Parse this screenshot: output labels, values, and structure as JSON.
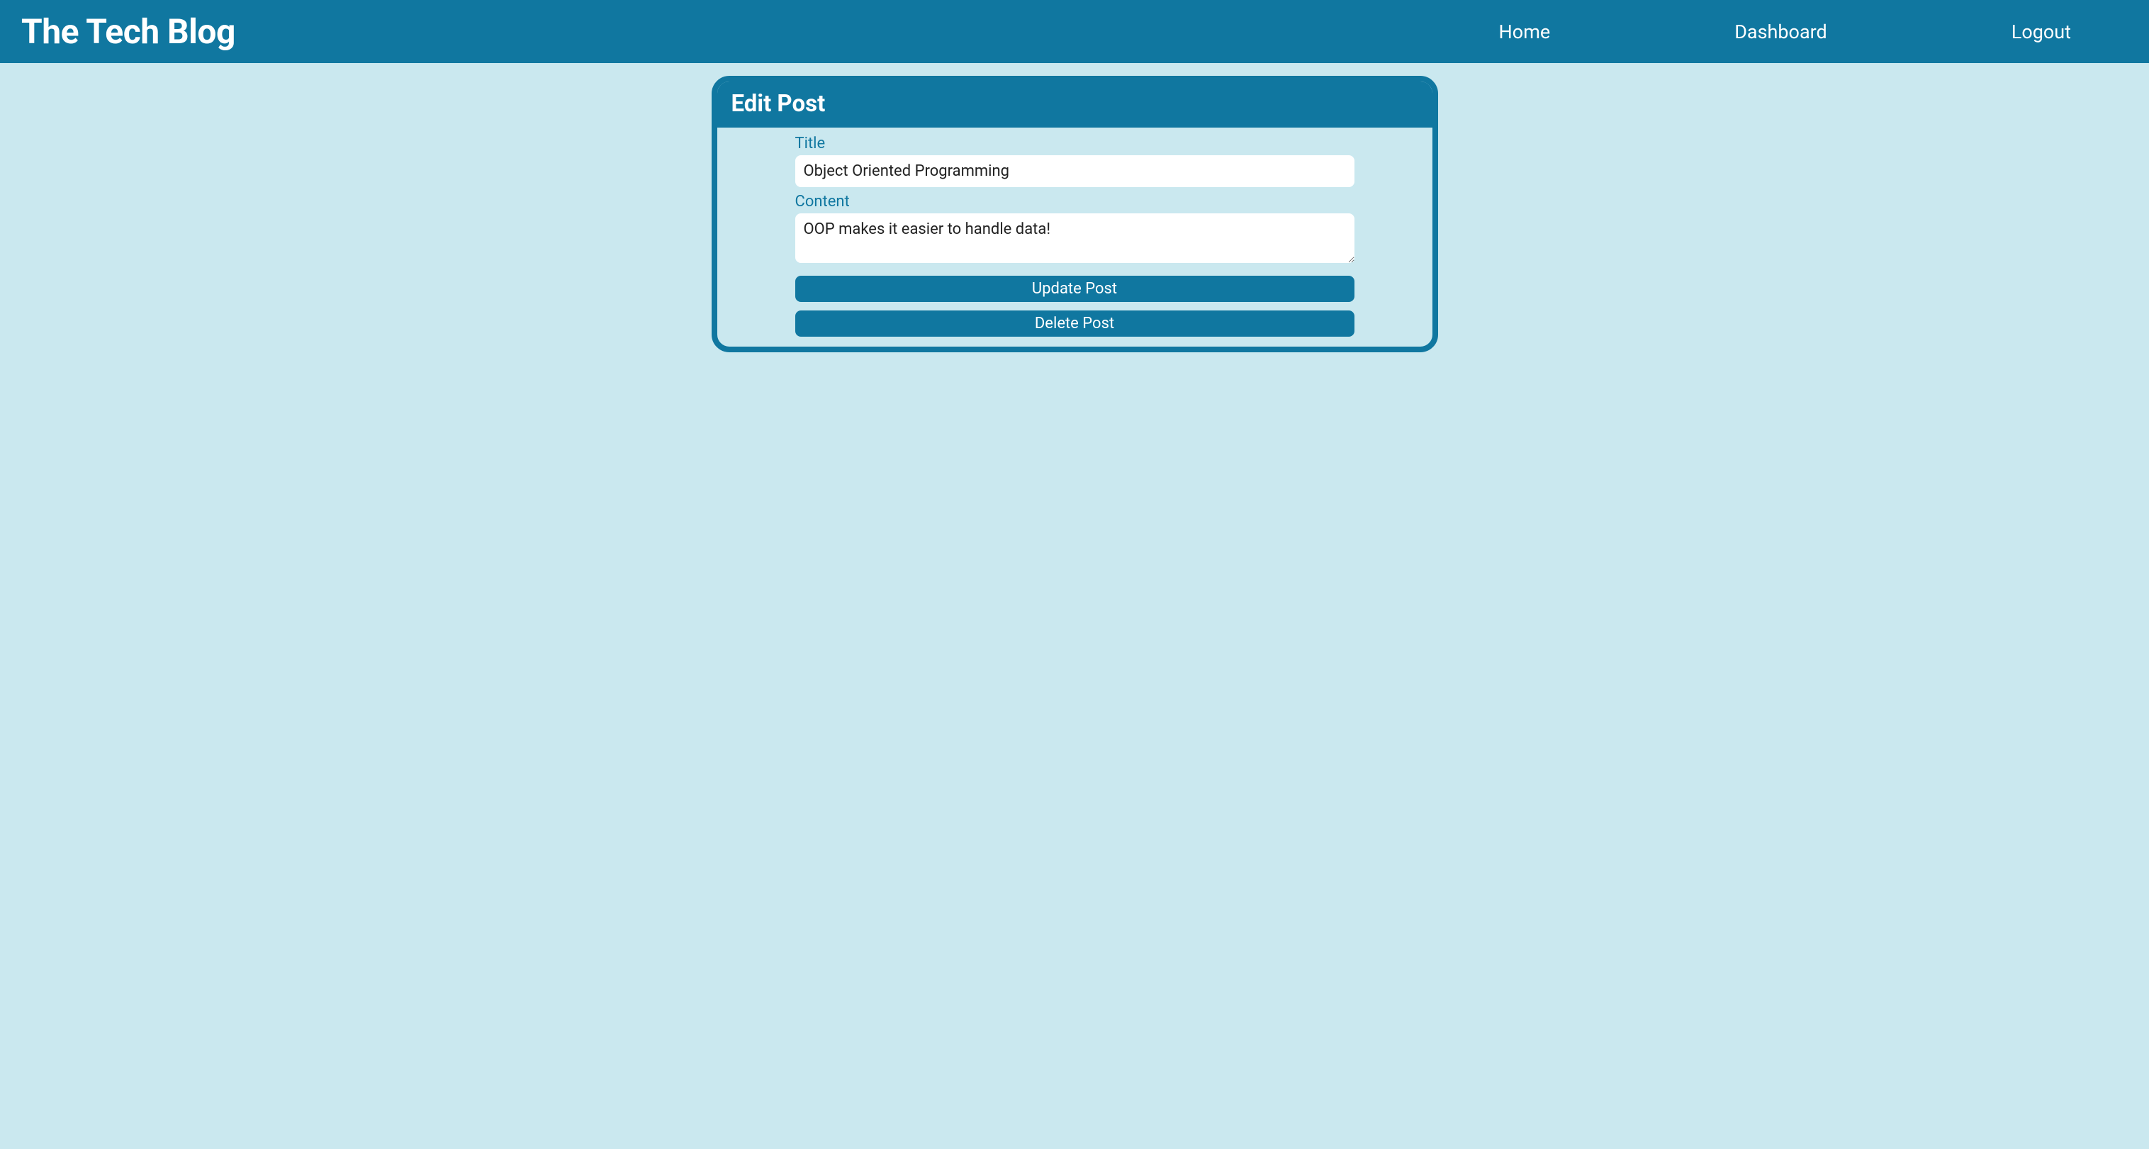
{
  "header": {
    "site_title": "The Tech Blog",
    "nav": {
      "home": "Home",
      "dashboard": "Dashboard",
      "logout": "Logout"
    }
  },
  "card": {
    "header_title": "Edit Post",
    "form": {
      "title_label": "Title",
      "title_value": "Object Oriented Programming",
      "content_label": "Content",
      "content_value": "OOP makes it easier to handle data!",
      "update_button": "Update Post",
      "delete_button": "Delete Post"
    }
  }
}
